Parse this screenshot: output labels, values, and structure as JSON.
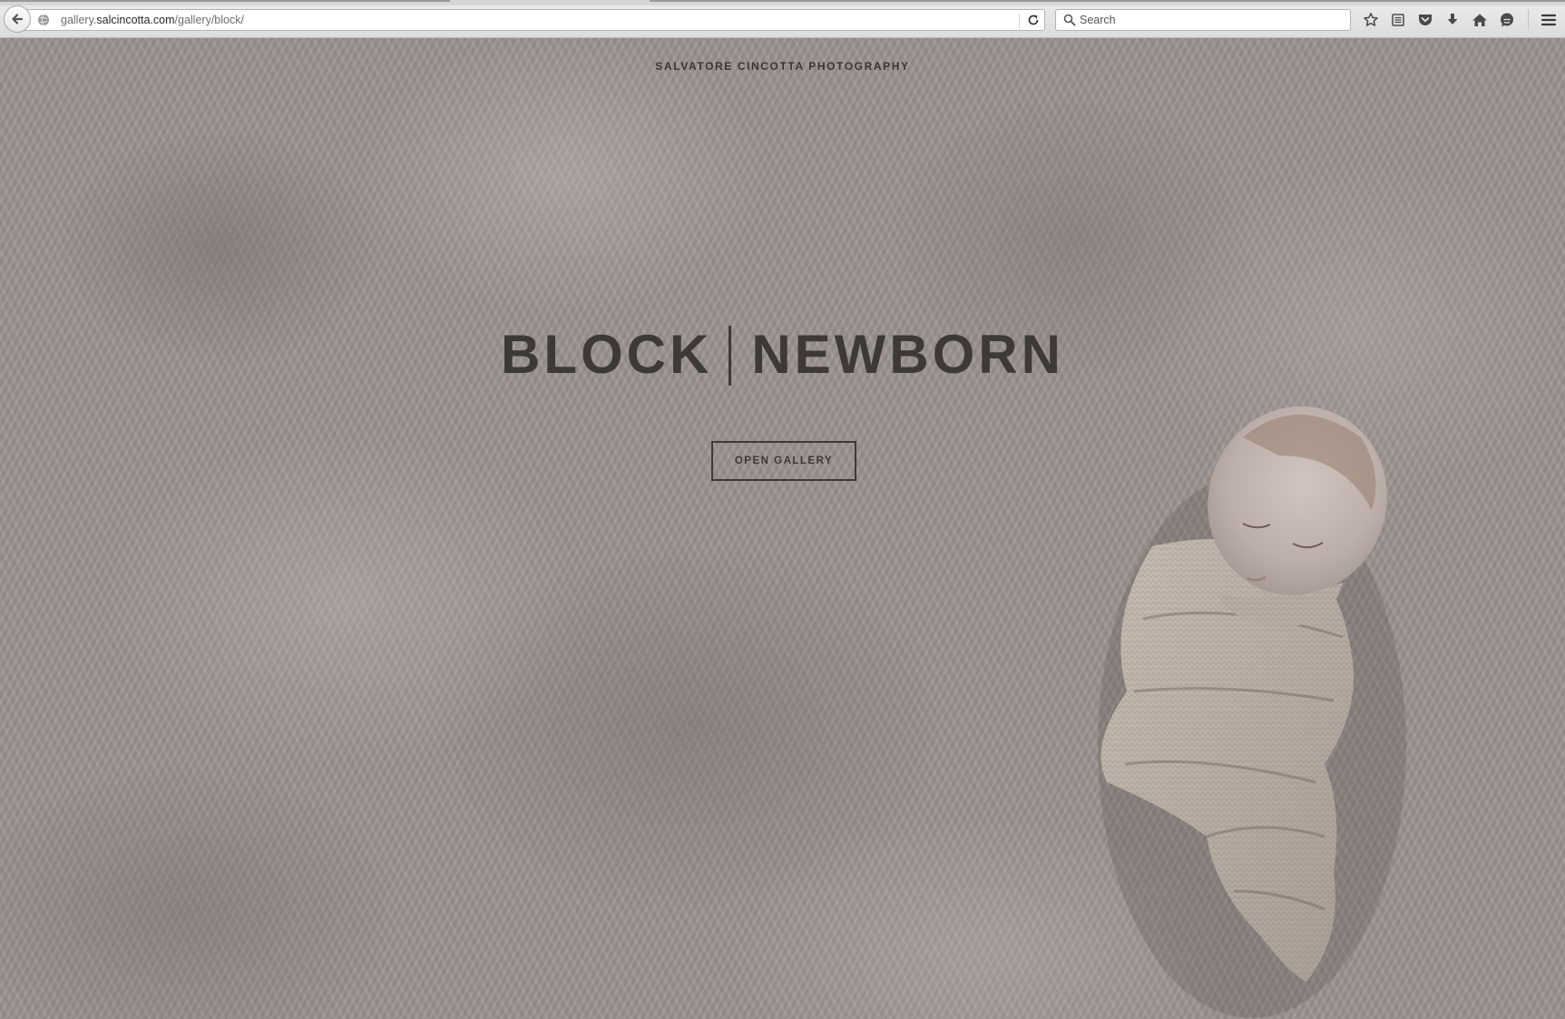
{
  "browser": {
    "url_prefix": "gallery.",
    "url_domain": "salcincotta.com",
    "url_path": "/gallery/block/",
    "search_placeholder": "Search",
    "toolbar_icons": [
      "star-icon",
      "reading-list-icon",
      "pocket-icon",
      "download-icon",
      "home-icon",
      "chat-icon",
      "menu-icon"
    ]
  },
  "page": {
    "brand": "SALVATORE CINCOTTA PHOTOGRAPHY",
    "title_left": "BLOCK",
    "title_right": "NEWBORN",
    "cta_label": "OPEN GALLERY",
    "background_color": "#9b928f",
    "text_color": "#3d3937"
  }
}
